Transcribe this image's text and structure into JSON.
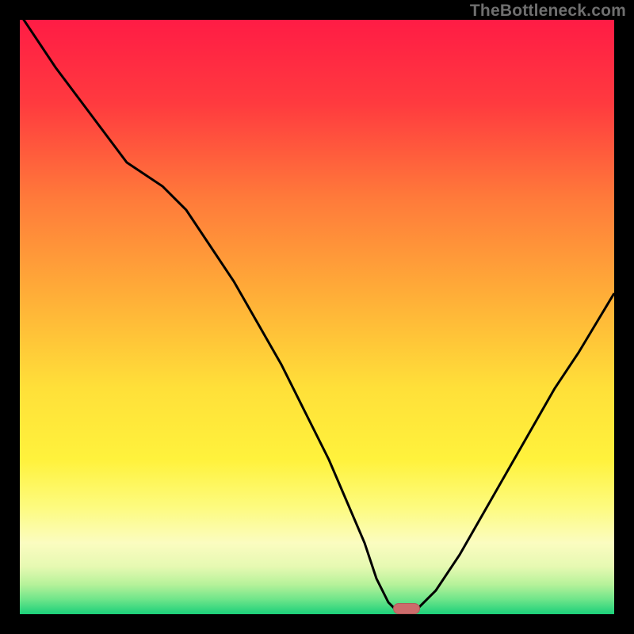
{
  "watermark": "TheBottleneck.com",
  "chart_data": {
    "type": "line",
    "title": "",
    "xlabel": "",
    "ylabel": "",
    "xlim": [
      0,
      100
    ],
    "ylim": [
      0,
      100
    ],
    "x": [
      0,
      6,
      12,
      18,
      24,
      28,
      32,
      36,
      40,
      44,
      48,
      52,
      55,
      58,
      60,
      62,
      64,
      66,
      70,
      74,
      78,
      82,
      86,
      90,
      94,
      100
    ],
    "values": [
      101,
      92,
      84,
      76,
      72,
      68,
      62,
      56,
      49,
      42,
      34,
      26,
      19,
      12,
      6,
      2,
      0,
      0,
      4,
      10,
      17,
      24,
      31,
      38,
      44,
      54
    ],
    "minimum_x": 65,
    "gradient_stops": [
      {
        "pct": 0,
        "color": "#ff1c45"
      },
      {
        "pct": 14,
        "color": "#ff3a3f"
      },
      {
        "pct": 30,
        "color": "#ff7a3a"
      },
      {
        "pct": 48,
        "color": "#ffb338"
      },
      {
        "pct": 62,
        "color": "#ffe039"
      },
      {
        "pct": 74,
        "color": "#fff23c"
      },
      {
        "pct": 82,
        "color": "#fdfb7f"
      },
      {
        "pct": 88,
        "color": "#fbfcc0"
      },
      {
        "pct": 92,
        "color": "#e6f9b2"
      },
      {
        "pct": 95,
        "color": "#b6f29a"
      },
      {
        "pct": 97.5,
        "color": "#6fe58a"
      },
      {
        "pct": 100,
        "color": "#1bd07a"
      }
    ],
    "marker": {
      "fill": "#cc6b6b",
      "stroke": "#b25a5a"
    }
  }
}
